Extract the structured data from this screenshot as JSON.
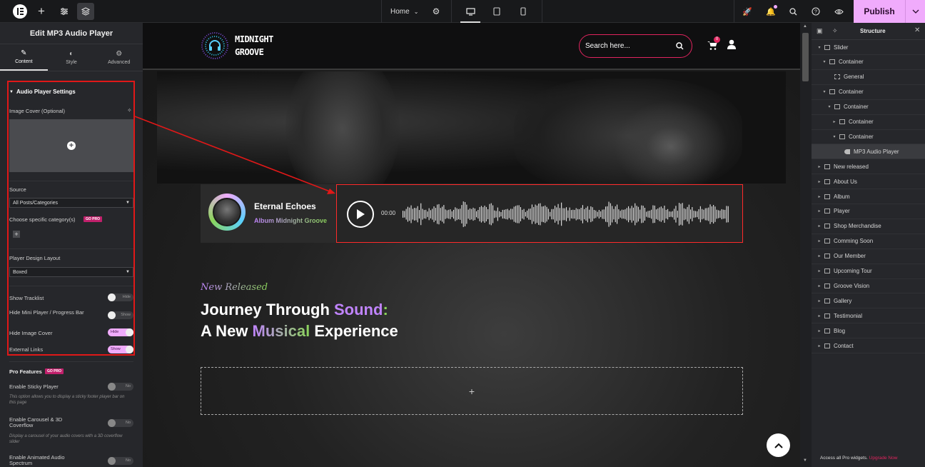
{
  "topbar": {
    "home_label": "Home",
    "publish_label": "Publish"
  },
  "left_panel": {
    "title": "Edit MP3 Audio Player",
    "tabs": [
      {
        "label": "Content"
      },
      {
        "label": "Style"
      },
      {
        "label": "Advanced"
      }
    ],
    "section_title": "Audio Player Settings",
    "image_cover_label": "Image Cover (Optional)",
    "source_label": "Source",
    "source_value": "All Posts/Categories",
    "category_label": "Choose specific category(s)",
    "go_pro": "GO PRO",
    "layout_label": "Player Design Layout",
    "layout_value": "Boxed",
    "toggles": [
      {
        "label": "Show Tracklist",
        "state": "Hide",
        "on": false
      },
      {
        "label": "Hide Mini Player / Progress Bar",
        "state": "Show",
        "on": false
      },
      {
        "label": "Hide Image Cover",
        "state": "Hide",
        "on": true
      },
      {
        "label": "External Links",
        "state": "Show",
        "on": true
      }
    ],
    "pro_features_label": "Pro Features",
    "pro_toggles": [
      {
        "label": "Enable Sticky Player",
        "state": "No",
        "desc": "This option allows you to display a sticky footer player bar on this page"
      },
      {
        "label": "Enable Carousel & 3D Coverflow",
        "state": "No",
        "desc": "Display a carousel of your audio covers with a 3D coverflow slider"
      },
      {
        "label": "Enable Animated Audio Spectrum",
        "state": "No",
        "desc": ""
      }
    ]
  },
  "site": {
    "logo_line1": "MIDNIGHT",
    "logo_line2": "GROOVE",
    "search_placeholder": "Search here...",
    "cart_count": "0",
    "track_title": "Eternal Echoes",
    "track_album": "Album Midnight Groove",
    "time": "00:00",
    "tagline": "New Released",
    "heading_line1_a": "Journey Through ",
    "heading_line1_b": "Sound",
    "heading_line1_c": ":",
    "heading_line2_a": "A New ",
    "heading_line2_b": "Musical",
    "heading_line2_c": " Experience"
  },
  "structure": {
    "title": "Structure",
    "items": [
      {
        "label": "Slider",
        "depth": 0,
        "arrow": "▾"
      },
      {
        "label": "Container",
        "depth": 1,
        "arrow": "▾"
      },
      {
        "label": "General",
        "depth": 2,
        "arrow": ""
      },
      {
        "label": "Container",
        "depth": 1,
        "arrow": "▾"
      },
      {
        "label": "Container",
        "depth": 2,
        "arrow": "▾"
      },
      {
        "label": "Container",
        "depth": 3,
        "arrow": "▸"
      },
      {
        "label": "Container",
        "depth": 3,
        "arrow": "▾"
      },
      {
        "label": "MP3 Audio Player",
        "depth": 4,
        "arrow": ""
      },
      {
        "label": "New released",
        "depth": 0,
        "arrow": "▸"
      },
      {
        "label": "About Us",
        "depth": 0,
        "arrow": "▸"
      },
      {
        "label": "Album",
        "depth": 0,
        "arrow": "▸"
      },
      {
        "label": "Player",
        "depth": 0,
        "arrow": "▸"
      },
      {
        "label": "Shop Merchandise",
        "depth": 0,
        "arrow": "▸"
      },
      {
        "label": "Comming Soon",
        "depth": 0,
        "arrow": "▸"
      },
      {
        "label": "Our Member",
        "depth": 0,
        "arrow": "▸"
      },
      {
        "label": "Upcoming Tour",
        "depth": 0,
        "arrow": "▸"
      },
      {
        "label": "Groove Vision",
        "depth": 0,
        "arrow": "▸"
      },
      {
        "label": "Gallery",
        "depth": 0,
        "arrow": "▸"
      },
      {
        "label": "Testimonial",
        "depth": 0,
        "arrow": "▸"
      },
      {
        "label": "Blog",
        "depth": 0,
        "arrow": "▸"
      },
      {
        "label": "Contact",
        "depth": 0,
        "arrow": "▸"
      }
    ],
    "footer_text": "Access all Pro widgets.",
    "footer_link": "Upgrade Now"
  }
}
